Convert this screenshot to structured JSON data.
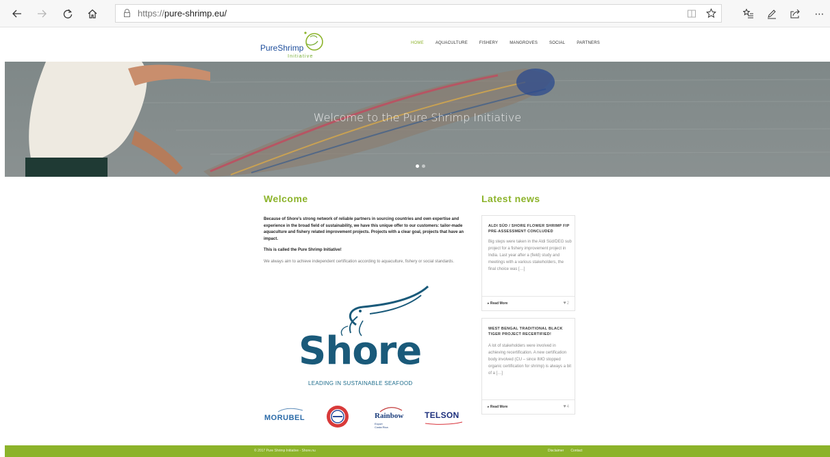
{
  "browser": {
    "url_protocol": "https://",
    "url_domain": "pure-shrimp.eu/",
    "icons": {
      "back": "arrow-left-icon",
      "forward": "arrow-right-icon",
      "refresh": "refresh-icon",
      "home": "home-icon",
      "reading_view": "book-icon",
      "favorite": "star-icon",
      "favorites_hub": "favorites-list-icon",
      "notes": "pen-icon",
      "share": "share-icon",
      "more": "more-icon"
    }
  },
  "site": {
    "logo_text": "PureShrimp",
    "logo_subtext": "Initiative",
    "menu": [
      {
        "label": "HOME",
        "active": true
      },
      {
        "label": "AQUACULTURE",
        "active": false
      },
      {
        "label": "FISHERY",
        "active": false
      },
      {
        "label": "MANGROVES",
        "active": false
      },
      {
        "label": "SOCIAL",
        "active": false
      },
      {
        "label": "PARTNERS",
        "active": false
      }
    ],
    "hero_title": "Welcome to the Pure Shrimp Initiative",
    "accent_color": "#8cb32a"
  },
  "welcome": {
    "heading": "Welcome",
    "para1": "Because of Shore’s strong network of reliable partners in sourcing countries and own expertise and experience in the broad field of sustainability, we have this unique offer to our customers:  tailor-made aquaculture and fishery related improvement projects. Projects with a clear goal, projects that have an impact.",
    "para2": "This is called the Pure Shrimp Initiative!",
    "para3": "We always aim to achieve independent certification according to aquaculture, fishery or social standards."
  },
  "shore_logo": {
    "word": "Shore",
    "tagline": "LEADING IN SUSTAINABLE SEAFOOD"
  },
  "partners": {
    "morubel": "MORUBEL",
    "rainbow": "Rainbow",
    "rainbow_sub1": "Export",
    "rainbow_sub2": "Costa Rica",
    "telson": "TELSON"
  },
  "news": {
    "heading": "Latest news",
    "items": [
      {
        "title": "ALDI SÜD / SHORE FLOWER SHRIMP FIP PRE-ASSESSMENT CONCLUDED",
        "excerpt": "Big steps were taken in the Aldi Süd/DEG sub project for a fishery improvement project in India.  Last year after a (field) study and meetings with a various stakeholders,  the final choice was […]",
        "read_more": "Read More",
        "likes": "2"
      },
      {
        "title": "WEST BENGAL TRADITIONAL BLACK TIGER PROJECT RECERTIFIED!",
        "excerpt": "A lot of stakeholders were involved in achieving recertification. A new certification body involved  (CU – since IMO stopped organic certification for shrimp) is always a bit of a […]",
        "read_more": "Read More",
        "likes": "4"
      }
    ]
  },
  "footer": {
    "copyright": "© 2017 Pure Shrimp Initiative - Shore.nu",
    "link1": "Disclaimer",
    "link2": "Contact"
  }
}
